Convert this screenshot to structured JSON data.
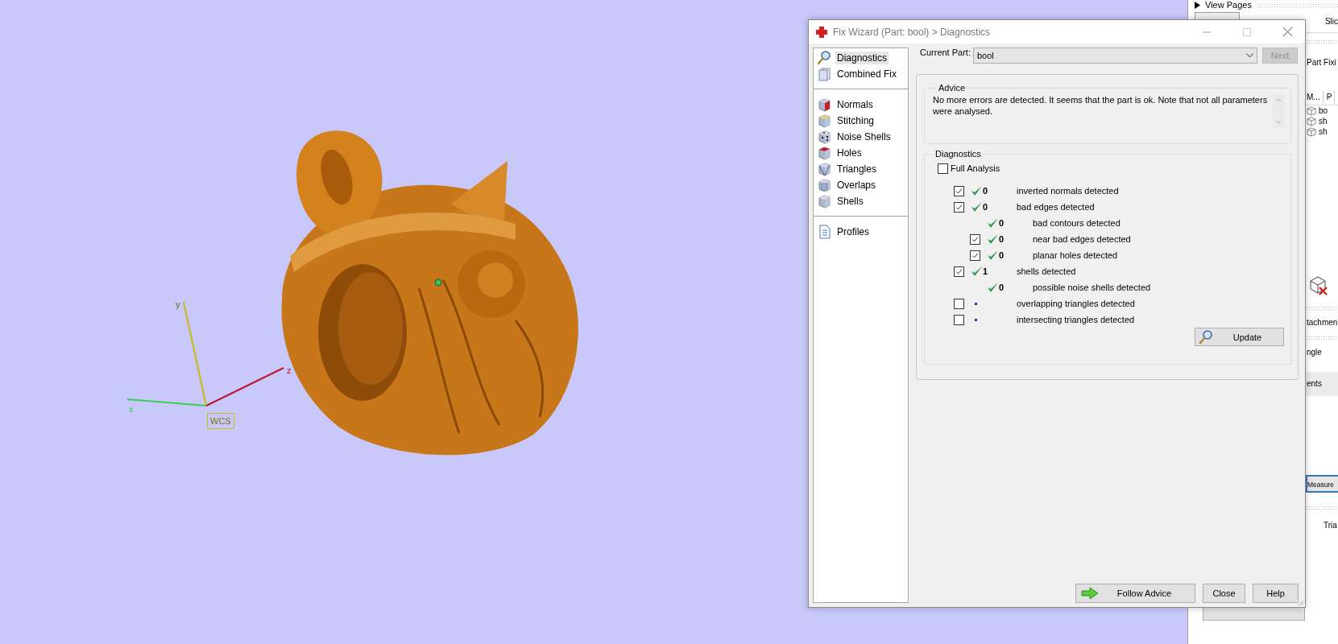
{
  "viewport": {
    "axes": [
      {
        "label": "x",
        "color": "#3ccc58"
      },
      {
        "label": "y",
        "color": "#c8bc20"
      },
      {
        "label": "z",
        "color": "#c0182c"
      }
    ],
    "frame_label": "WCS"
  },
  "right_panel": {
    "section": "View Pages",
    "tab": "Slic",
    "heading": "Part Fixi",
    "columns": [
      "M...",
      "P"
    ],
    "rows": [
      "bo",
      "sh",
      "sh"
    ],
    "labels": [
      "tachmen",
      "ngle"
    ],
    "band": "ents",
    "measure_tab": "Measure",
    "field_label": "Tria"
  },
  "window": {
    "title": "Fix Wizard (Part: bool) > Diagnostics"
  },
  "sidebar": {
    "groups": [
      {
        "items": [
          {
            "label": "Diagnostics",
            "selected": true
          },
          {
            "label": "Combined Fix",
            "selected": false
          }
        ]
      },
      {
        "items": [
          {
            "label": "Normals",
            "selected": false
          },
          {
            "label": "Stitching",
            "selected": false
          },
          {
            "label": "Noise Shells",
            "selected": false
          },
          {
            "label": "Holes",
            "selected": false
          },
          {
            "label": "Triangles",
            "selected": false
          },
          {
            "label": "Overlaps",
            "selected": false
          },
          {
            "label": "Shells",
            "selected": false
          }
        ]
      },
      {
        "items": [
          {
            "label": "Profiles",
            "selected": false
          }
        ]
      }
    ]
  },
  "current_part": {
    "label": "Current Part:",
    "value": "bool"
  },
  "next_button": {
    "label": "Next",
    "disabled": true
  },
  "advice": {
    "title": "Advice",
    "text": "No more errors are detected. It seems that the part is ok. Note that not all parameters were analysed."
  },
  "diagnostics": {
    "title": "Diagnostics",
    "full_analysis": {
      "label": "Full Analysis",
      "checked": false
    },
    "rows": [
      {
        "checked": true,
        "kind": "ok",
        "count": "0",
        "label": "inverted normals detected"
      },
      {
        "checked": true,
        "kind": "ok",
        "count": "0",
        "label": "bad edges detected",
        "children": [
          {
            "kind": "ok",
            "count": "0",
            "label": "bad contours detected"
          },
          {
            "checked": true,
            "kind": "ok",
            "count": "0",
            "label": "near bad edges detected"
          },
          {
            "checked": true,
            "kind": "ok",
            "count": "0",
            "label": "planar holes detected"
          }
        ]
      },
      {
        "checked": true,
        "kind": "ok",
        "count": "1",
        "label": "shells detected",
        "children": [
          {
            "kind": "ok",
            "count": "0",
            "label": "possible noise shells detected"
          }
        ]
      },
      {
        "checked": false,
        "kind": "pending",
        "label": "overlapping triangles detected"
      },
      {
        "checked": false,
        "kind": "pending",
        "label": "intersecting triangles detected"
      }
    ],
    "update_button": "Update"
  },
  "buttons": [
    "Follow Advice",
    "Close",
    "Help"
  ]
}
